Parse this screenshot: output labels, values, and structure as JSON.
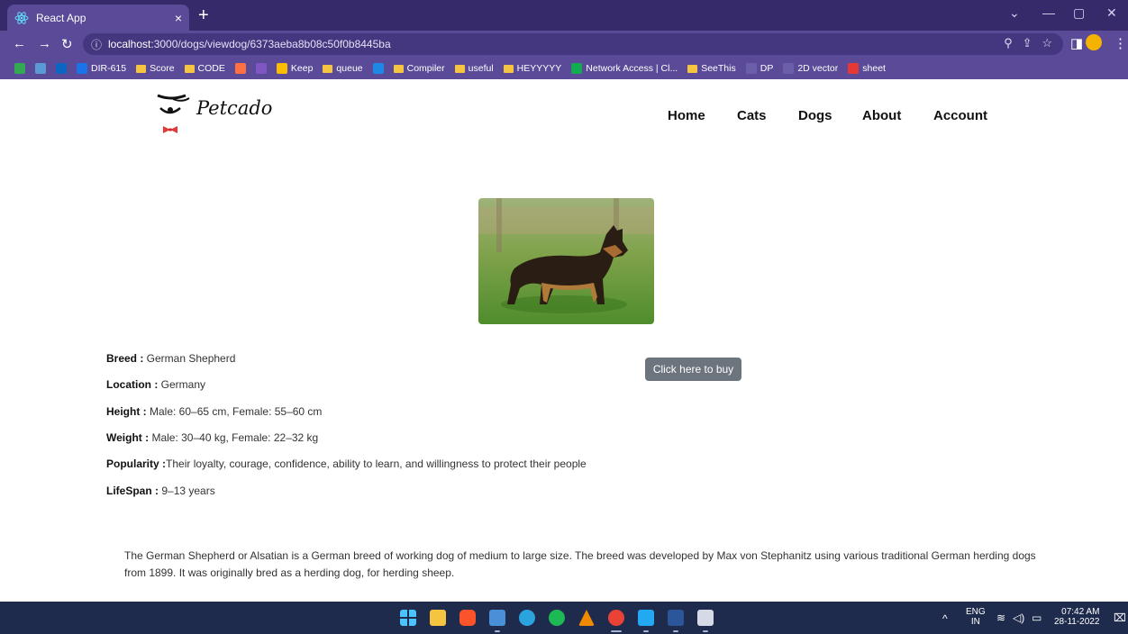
{
  "browser": {
    "tab_title": "React App",
    "tab_close": "×",
    "new_tab": "+",
    "url_host": "localhost",
    "url_path": ":3000/dogs/viewdog/6373aeba8b08c50f0b8445ba",
    "bookmarks": [
      {
        "label": "",
        "color": "#34a853",
        "kind": "drive"
      },
      {
        "label": "",
        "color": "#5b9bd5",
        "kind": "folder-blue"
      },
      {
        "label": "",
        "color": "#0a66c2",
        "kind": "in"
      },
      {
        "label": "DIR-615",
        "color": "#1a73e8",
        "kind": "d"
      },
      {
        "label": "Score",
        "color": "#f5c542",
        "kind": "folder"
      },
      {
        "label": "CODE",
        "color": "#f5c542",
        "kind": "folder"
      },
      {
        "label": "",
        "color": "#ff7043",
        "kind": "sq"
      },
      {
        "label": "",
        "color": "#7e57c2",
        "kind": "sq"
      },
      {
        "label": "Keep",
        "color": "#fbbc04",
        "kind": "sq"
      },
      {
        "label": "queue",
        "color": "#f5c542",
        "kind": "folder"
      },
      {
        "label": "",
        "color": "#1e88e5",
        "kind": "sq"
      },
      {
        "label": "Compiler",
        "color": "#f5c542",
        "kind": "folder"
      },
      {
        "label": "useful",
        "color": "#f5c542",
        "kind": "folder"
      },
      {
        "label": "HEYYYYY",
        "color": "#f5c542",
        "kind": "folder"
      },
      {
        "label": "Network Access | Cl...",
        "color": "#13aa52",
        "kind": "sq"
      },
      {
        "label": "SeeThis",
        "color": "#f5c542",
        "kind": "folder"
      },
      {
        "label": "DP",
        "color": "#6a5fa8",
        "kind": "sq"
      },
      {
        "label": "2D vector",
        "color": "#6a5fa8",
        "kind": "td"
      },
      {
        "label": "sheet",
        "color": "#e53935",
        "kind": "sq"
      }
    ]
  },
  "site": {
    "logo_text": "Petcado",
    "nav": [
      "Home",
      "Cats",
      "Dogs",
      "About",
      "Account"
    ]
  },
  "dog": {
    "breed_label": "Breed :",
    "breed": " German Shepherd",
    "location_label": "Location :",
    "location": " Germany",
    "height_label": "Height :",
    "height": " Male: 60–65 cm, Female: 55–60 cm",
    "weight_label": "Weight :",
    "weight": " Male: 30–40 kg, Female: 22–32 kg",
    "popularity_label": "Popularity :",
    "popularity": "Their loyalty, courage, confidence, ability to learn, and willingness to protect their people",
    "lifespan_label": "LifeSpan :",
    "lifespan": " 9–13 years",
    "buy_label": "Click here to buy",
    "description": "The German Shepherd or Alsatian is a German breed of working dog of medium to large size. The breed was developed by Max von Stephanitz using various traditional German herding dogs from 1899. It was originally bred as a herding dog, for herding sheep."
  },
  "taskbar": {
    "lang_top": "ENG",
    "lang_bottom": "IN",
    "time": "07:42 AM",
    "date": "28-11-2022"
  },
  "colors": {
    "browser_frame": "#372a6b",
    "toolbar": "#5a4a97",
    "buy_button": "#6c757d",
    "taskbar": "#1f2b4d"
  }
}
